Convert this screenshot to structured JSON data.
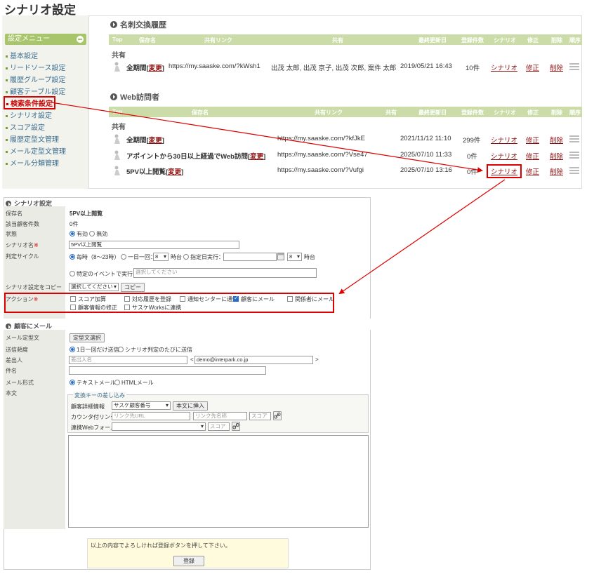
{
  "page_title": "シナリオ設定",
  "sidebar": {
    "header": "設定メニュー",
    "items": [
      "基本設定",
      "リードソース設定",
      "履歴グループ設定",
      "顧客テーブル設定",
      "検索条件設定",
      "シナリオ設定",
      "スコア設定",
      "履歴定型文管理",
      "メール定型文管理",
      "メール分類管理"
    ]
  },
  "meishi": {
    "title": "名刺交換履歴",
    "headers": [
      "Top",
      "保存名",
      "共有リンク",
      "共有",
      "最終更新日",
      "登録件数",
      "シナリオ",
      "修正",
      "削除",
      "順序"
    ],
    "group": "共有",
    "rows": [
      {
        "name": "全期間",
        "change": "変更",
        "link": "https://my.saaske.com/?kWsh1",
        "share": "出茂 太郎, 出茂 京子, 出茂 次郎, 案件 太郎",
        "date": "2019/05/21 16:43",
        "count": "10件",
        "scenario": "シナリオ",
        "edit": "修正",
        "del": "削除"
      }
    ]
  },
  "web": {
    "title": "Web訪問者",
    "headers": [
      "Top",
      "保存名",
      "共有リンク",
      "共有",
      "最終更新日",
      "登録件数",
      "シナリオ",
      "修正",
      "削除",
      "順序"
    ],
    "group": "共有",
    "rows": [
      {
        "name": "全期間",
        "change": "変更",
        "link": "https://my.saaske.com/?kfJkE",
        "date": "2021/11/12 11:10",
        "count": "299件",
        "scenario": "シナリオ",
        "edit": "修正",
        "del": "削除"
      },
      {
        "name": "アポイントから30日以上経過でWeb訪問",
        "change": "変更",
        "link": "https://my.saaske.com/?Vse47",
        "date": "2025/07/10 11:33",
        "count": "0件",
        "scenario": "シナリオ",
        "edit": "修正",
        "del": "削除"
      },
      {
        "name": "5PV以上閲覧",
        "change": "変更",
        "link": "https://my.saaske.com/?Vufgi",
        "date": "2025/07/10 13:16",
        "count": "0件",
        "scenario": "シナリオ",
        "edit": "修正",
        "del": "削除"
      }
    ]
  },
  "form": {
    "title": "シナリオ設定",
    "labels": {
      "save_name": "保存名",
      "count": "該当顧客件数",
      "status": "状態",
      "scenario_name": "シナリオ名",
      "cycle": "判定サイクル",
      "copy": "シナリオ設定をコピー",
      "action": "アクション"
    },
    "save_name_value": "5PV以上閲覧",
    "count_value": "0件",
    "status_on": "有効",
    "status_off": "無効",
    "scenario_name_value": "5PV以上閲覧",
    "cycle_hourly": "毎時（8〜23時）",
    "cycle_daily": "一日一回：",
    "daily_hour": "8",
    "hour_suffix": "時台",
    "cycle_date": "指定日実行：",
    "date_hour": "8",
    "cycle_event": "特定のイベントで実行：",
    "event_placeholder": "選択してください",
    "copy_select": "選択してください",
    "copy_button": "コピー",
    "actions": [
      {
        "label": "スコア加算",
        "checked": false
      },
      {
        "label": "対応履歴を登録",
        "checked": false
      },
      {
        "label": "通知センターに通知",
        "checked": false
      },
      {
        "label": "顧客にメール",
        "checked": true
      },
      {
        "label": "関係者にメール",
        "checked": false
      },
      {
        "label": "顧客情報の修正",
        "checked": false
      },
      {
        "label": "サスケWorksに連携",
        "checked": false
      }
    ]
  },
  "mail": {
    "title": "顧客にメール",
    "labels": {
      "template": "メール定型文",
      "frequency": "送信頻度",
      "sender": "差出人",
      "subject": "件名",
      "format": "メール形式",
      "body": "本文"
    },
    "template_button": "定型文選択",
    "freq_once": "1日一回だけ送信",
    "freq_every": "シナリオ判定のたびに送信",
    "sender_name_placeholder": "差出人名",
    "sender_email": "demo@interpark.co.jp",
    "format_text": "テキストメール",
    "format_html": "HTMLメール",
    "insert_legend": "変換キーの差し込み",
    "insert_customer_label": "顧客詳細情報",
    "insert_customer_select": "サスケ顧客番号",
    "insert_button": "本文に挿入",
    "counter_link_label": "カウンタ付リンク",
    "link_url_placeholder": "リンク先URL",
    "link_name_placeholder": "リンク先名称",
    "score_placeholder": "スコア",
    "webform_label": "連携Webフォーム",
    "note": "以上の内容でよろしければ登録ボタンを押して下さい。",
    "submit": "登録"
  }
}
